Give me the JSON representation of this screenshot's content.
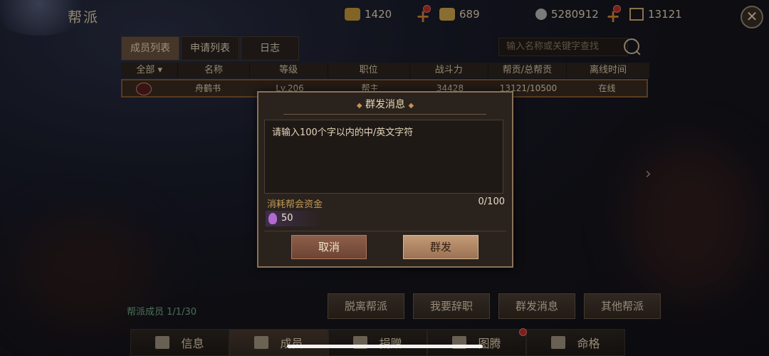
{
  "header": {
    "title": "帮派",
    "gold": "1420",
    "ingot": "689",
    "coins": "5280912",
    "contribution": "13121"
  },
  "tabs": [
    "成员列表",
    "申请列表",
    "日志"
  ],
  "search": {
    "placeholder": "输入名称或关键字查找"
  },
  "table": {
    "headers": [
      "全部",
      "名称",
      "等级",
      "职位",
      "战斗力",
      "帮贡/总帮贡",
      "离线时间"
    ],
    "row": {
      "name": "舟鹤书",
      "level": "Lv.206",
      "position": "帮主",
      "power": "34428",
      "contribution": "13121/10500",
      "status": "在线"
    }
  },
  "footer": {
    "members_label": "帮派成员",
    "members_count": "1/1/30",
    "buttons": [
      "脱离帮派",
      "我要辞职",
      "群发消息",
      "其他帮派"
    ],
    "nav": [
      "信息",
      "成员",
      "捐赠",
      "图腾",
      "命格"
    ]
  },
  "modal": {
    "title": "群发消息",
    "placeholder": "请输入100个字以内的中/英文字符",
    "cost_label": "消耗帮会资金",
    "counter": "0/100",
    "cost_value": "50",
    "cancel": "取消",
    "send": "群发"
  },
  "colors": {
    "accent": "#c29a58",
    "badge": "#c0302a",
    "member_green": "#6fae86"
  }
}
